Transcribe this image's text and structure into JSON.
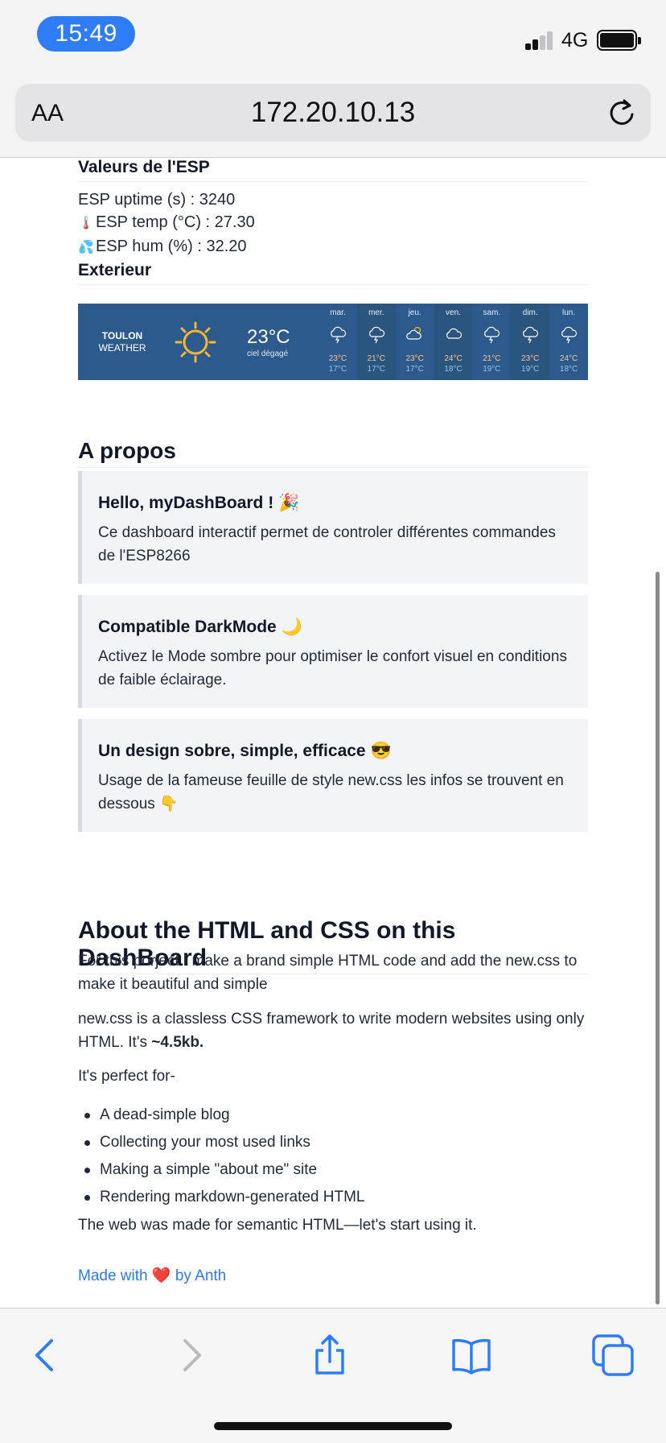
{
  "status_bar": {
    "time": "15:49",
    "network": "4G"
  },
  "safari": {
    "aa_label": "AA",
    "url": "172.20.10.13"
  },
  "esp": {
    "title": "Valeurs de l'ESP",
    "uptime": "ESP uptime (s) : 3240",
    "temp": "ESP temp (°C) : 27.30",
    "hum": "ESP hum (%) : 32.20"
  },
  "exterior": {
    "title": "Exterieur",
    "weather": {
      "city": "TOULON",
      "label": "WEATHER",
      "current_temp": "23°C",
      "condition": "ciel dégagé",
      "days": [
        {
          "name": "mar.",
          "icon": "rain-cloud-icon",
          "hi": "23°C",
          "lo": "17°C"
        },
        {
          "name": "mer.",
          "icon": "rain-cloud-icon",
          "hi": "21°C",
          "lo": "17°C"
        },
        {
          "name": "jeu.",
          "icon": "partly-cloudy-icon",
          "hi": "23°C",
          "lo": "17°C"
        },
        {
          "name": "ven.",
          "icon": "cloud-icon",
          "hi": "24°C",
          "lo": "18°C"
        },
        {
          "name": "sam.",
          "icon": "rain-cloud-icon",
          "hi": "21°C",
          "lo": "19°C"
        },
        {
          "name": "dim.",
          "icon": "rain-cloud-icon",
          "hi": "23°C",
          "lo": "19°C"
        },
        {
          "name": "lun.",
          "icon": "rain-cloud-icon",
          "hi": "24°C",
          "lo": "18°C"
        }
      ]
    }
  },
  "apropos": {
    "title": "A propos",
    "cards": [
      {
        "title": "Hello, myDashBoard ! 🎉",
        "body": "Ce dashboard interactif permet de controler différentes commandes de l'ESP8266"
      },
      {
        "title": "Compatible DarkMode 🌙",
        "body": "Activez le Mode sombre pour optimiser le confort visuel en conditions de faible éclairage."
      },
      {
        "title": "Un design sobre, simple, efficace 😎",
        "body": "Usage de la fameuse feuille de style new.css les infos se trouvent en dessous 👇"
      }
    ]
  },
  "about": {
    "title": "About the HTML and CSS on this DashBoard",
    "p1": "For this porject I make a brand simple HTML code and add the new.css to make it beautiful and simple",
    "p2_text": "new.css is a classless CSS framework to write modern websites using only HTML. It's",
    "p2_bold": "~4.5kb.",
    "p3": "It's perfect for-",
    "list": [
      "A dead-simple blog",
      "Collecting your most used links",
      "Making a simple \"about me\" site",
      "Rendering markdown-generated HTML"
    ],
    "p4": "The web was made for semantic HTML—let's start using it.",
    "made_with_prefix": "Made with",
    "made_with_heart": "❤️",
    "made_with_suffix": "by Anth"
  },
  "colors": {
    "accent": "#2f7df6",
    "link": "#2c7be5",
    "weather_bg": "#2c5a8c"
  }
}
